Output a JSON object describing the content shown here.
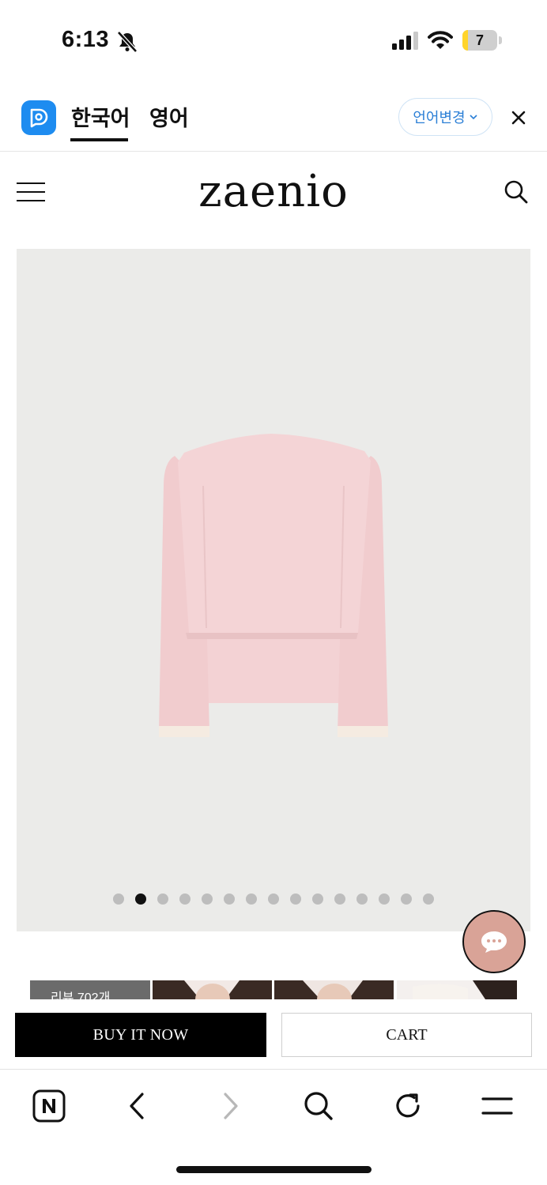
{
  "status_bar": {
    "time": "6:13",
    "battery": "7",
    "battery_level": 0.07
  },
  "translate_bar": {
    "tabs": [
      {
        "label": "한국어",
        "active": true
      },
      {
        "label": "영어",
        "active": false
      }
    ],
    "language_change_label": "언어변경"
  },
  "site": {
    "brand": "zaenio"
  },
  "product": {
    "image_alt": "pink layered long sleeve top",
    "carousel": {
      "total_slides": 15,
      "active_index": 1
    }
  },
  "thumbnails": {
    "review_label": "리뷰 702개"
  },
  "actions": {
    "buy_now": "BUY IT NOW",
    "cart": "CART"
  },
  "browser_toolbar": {
    "icons": [
      "naver-home-icon",
      "back-icon",
      "forward-icon",
      "search-icon",
      "refresh-icon",
      "menu-icon"
    ]
  },
  "colors": {
    "accent_blue": "#1e8cf0",
    "chat_button": "#d9a397",
    "buy_button": "#000000",
    "image_bg": "#ebebe9"
  }
}
